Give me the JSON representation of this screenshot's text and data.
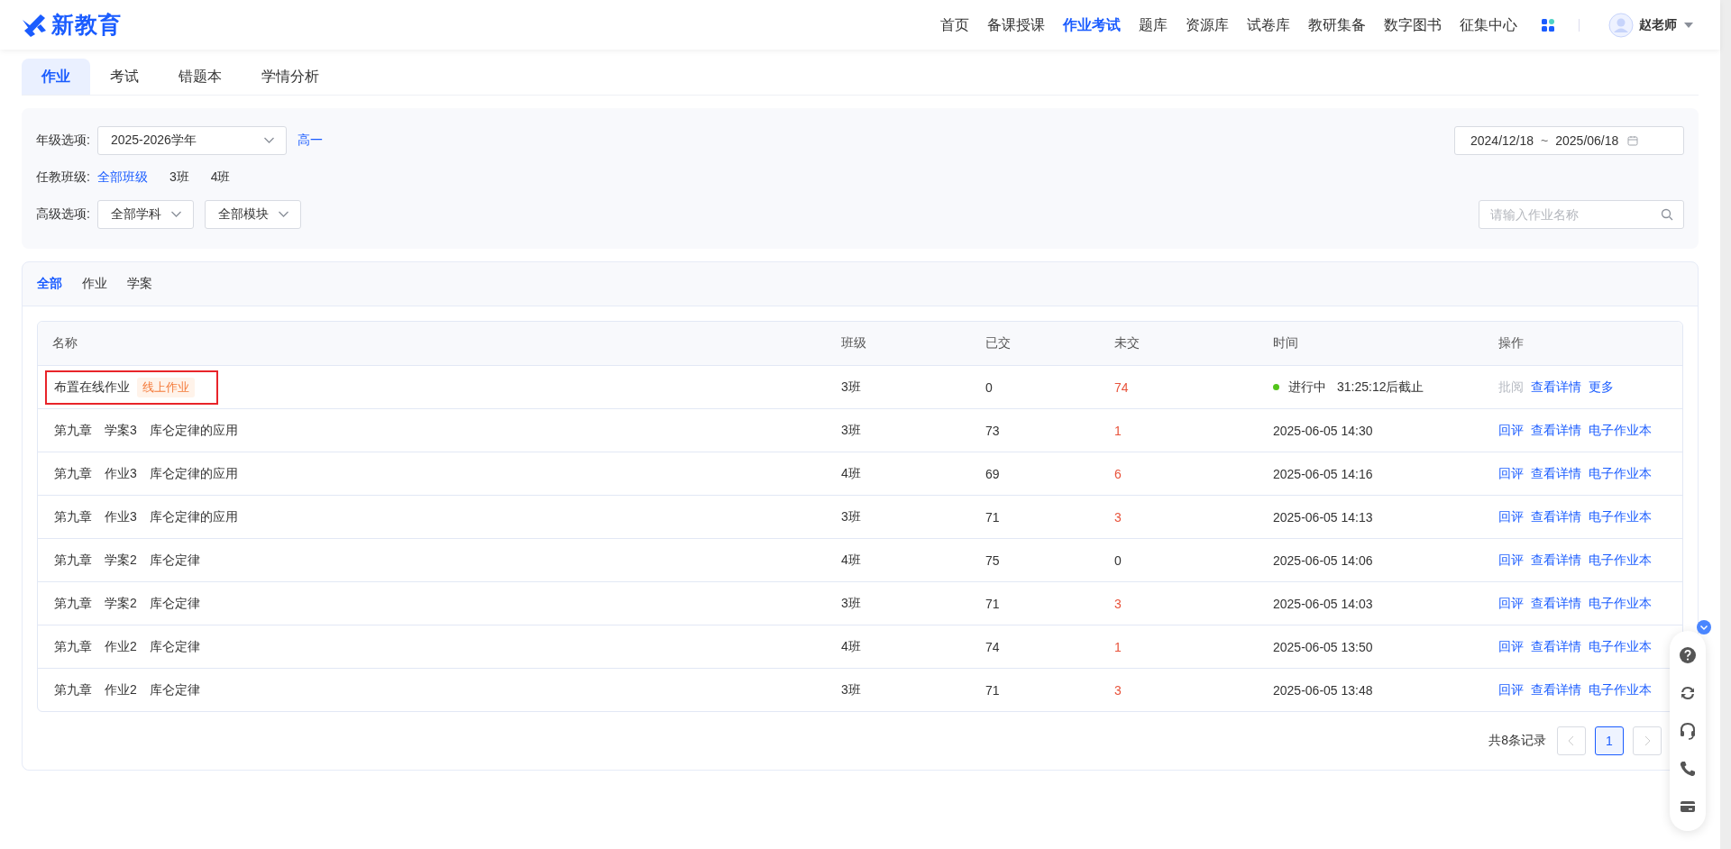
{
  "header": {
    "logo": "新教育",
    "nav": [
      {
        "label": "首页",
        "selected": false
      },
      {
        "label": "备课授课",
        "selected": false
      },
      {
        "label": "作业考试",
        "selected": true
      },
      {
        "label": "题库",
        "selected": false
      },
      {
        "label": "资源库",
        "selected": false
      },
      {
        "label": "试卷库",
        "selected": false
      },
      {
        "label": "教研集备",
        "selected": false
      },
      {
        "label": "数字图书",
        "selected": false
      },
      {
        "label": "征集中心",
        "selected": false
      }
    ],
    "user": "赵老师"
  },
  "tabs": [
    {
      "label": "作业",
      "selected": true
    },
    {
      "label": "考试",
      "selected": false
    },
    {
      "label": "错题本",
      "selected": false
    },
    {
      "label": "学情分析",
      "selected": false
    }
  ],
  "filters": {
    "grade_label": "年级选项:",
    "year": "2025-2026学年",
    "grade": "高一",
    "class_label": "任教班级:",
    "classes": [
      {
        "label": "全部班级",
        "selected": true
      },
      {
        "label": "3班",
        "selected": false
      },
      {
        "label": "4班",
        "selected": false
      }
    ],
    "advanced_label": "高级选项:",
    "subject": "全部学科",
    "module": "全部模块",
    "date_start": "2024/12/18",
    "date_sep": "~",
    "date_end": "2025/06/18",
    "search": {
      "placeholder": "请输入作业名称"
    }
  },
  "type_tabs": [
    {
      "label": "全部",
      "selected": true
    },
    {
      "label": "作业",
      "selected": false
    },
    {
      "label": "学案",
      "selected": false
    }
  ],
  "table": {
    "columns": [
      "名称",
      "班级",
      "已交",
      "未交",
      "时间",
      "操作"
    ],
    "rows": [
      {
        "name": "布置在线作业",
        "tag": "线上作业",
        "highlighted": true,
        "class": "3班",
        "submitted": "0",
        "unsubmitted": "74",
        "alert": true,
        "status": "进行中",
        "time": "31:25:12后截止",
        "actions": [
          {
            "label": "批阅",
            "disabled": true
          },
          {
            "label": "查看详情",
            "disabled": false
          },
          {
            "label": "更多",
            "disabled": false
          }
        ]
      },
      {
        "name": "第九章　学案3　库仑定律的应用",
        "highlighted": false,
        "class": "3班",
        "submitted": "73",
        "unsubmitted": "1",
        "alert": true,
        "time": "2025-06-05 14:30",
        "actions": [
          {
            "label": "回评",
            "disabled": false
          },
          {
            "label": "查看详情",
            "disabled": false
          },
          {
            "label": "电子作业本",
            "disabled": false
          }
        ]
      },
      {
        "name": "第九章　作业3　库仑定律的应用",
        "highlighted": false,
        "class": "4班",
        "submitted": "69",
        "unsubmitted": "6",
        "alert": true,
        "time": "2025-06-05 14:16",
        "actions": [
          {
            "label": "回评",
            "disabled": false
          },
          {
            "label": "查看详情",
            "disabled": false
          },
          {
            "label": "电子作业本",
            "disabled": false
          }
        ]
      },
      {
        "name": "第九章　作业3　库仑定律的应用",
        "highlighted": false,
        "class": "3班",
        "submitted": "71",
        "unsubmitted": "3",
        "alert": true,
        "time": "2025-06-05 14:13",
        "actions": [
          {
            "label": "回评",
            "disabled": false
          },
          {
            "label": "查看详情",
            "disabled": false
          },
          {
            "label": "电子作业本",
            "disabled": false
          }
        ]
      },
      {
        "name": "第九章　学案2　库仑定律",
        "highlighted": false,
        "class": "4班",
        "submitted": "75",
        "unsubmitted": "0",
        "alert": false,
        "time": "2025-06-05 14:06",
        "actions": [
          {
            "label": "回评",
            "disabled": false
          },
          {
            "label": "查看详情",
            "disabled": false
          },
          {
            "label": "电子作业本",
            "disabled": false
          }
        ]
      },
      {
        "name": "第九章　学案2　库仑定律",
        "highlighted": false,
        "class": "3班",
        "submitted": "71",
        "unsubmitted": "3",
        "alert": true,
        "time": "2025-06-05 14:03",
        "actions": [
          {
            "label": "回评",
            "disabled": false
          },
          {
            "label": "查看详情",
            "disabled": false
          },
          {
            "label": "电子作业本",
            "disabled": false
          }
        ]
      },
      {
        "name": "第九章　作业2　库仑定律",
        "highlighted": false,
        "class": "4班",
        "submitted": "74",
        "unsubmitted": "1",
        "alert": true,
        "time": "2025-06-05 13:50",
        "actions": [
          {
            "label": "回评",
            "disabled": false
          },
          {
            "label": "查看详情",
            "disabled": false
          },
          {
            "label": "电子作业本",
            "disabled": false
          }
        ]
      },
      {
        "name": "第九章　作业2　库仑定律",
        "highlighted": false,
        "class": "3班",
        "submitted": "71",
        "unsubmitted": "3",
        "alert": true,
        "time": "2025-06-05 13:48",
        "actions": [
          {
            "label": "回评",
            "disabled": false
          },
          {
            "label": "查看详情",
            "disabled": false
          },
          {
            "label": "电子作业本",
            "disabled": false
          }
        ]
      }
    ]
  },
  "pagination": {
    "total": "共8条记录",
    "pages": [
      {
        "label": "1",
        "selected": true
      }
    ],
    "prev_disabled": true,
    "next_disabled": true
  }
}
